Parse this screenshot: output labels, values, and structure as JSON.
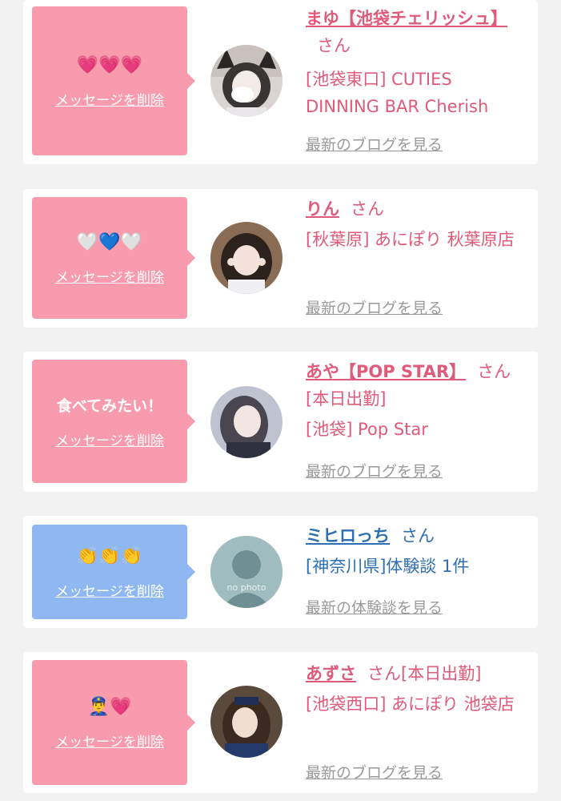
{
  "delete_label": "メッセージを削除",
  "colors": {
    "pink": "#f89bad",
    "blue": "#8fb8f2",
    "name_pink": "#e05a7a",
    "name_blue": "#2d6fb5"
  },
  "items": [
    {
      "message": "💗💗💗",
      "name": "まゆ【池袋チェリッシュ】",
      "san": "さん",
      "shop": "[池袋東口] CUTIES DINNING BAR Cherish",
      "more": "最新のブログを見る",
      "avatar": "girl-cat-ears-avatar"
    },
    {
      "message": "🤍💙🤍",
      "name": "りん",
      "san": "さん",
      "shop": "[秋葉原] あにぽり 秋葉原店",
      "more": "最新のブログを見る",
      "avatar": "girl-peace-sign-avatar"
    },
    {
      "message": "食べてみたい！",
      "name": "あや【POP STAR】",
      "san": "さん[本日出勤]",
      "shop": "[池袋] Pop Star",
      "more": "最新のブログを見る",
      "avatar": "girl-portrait-avatar"
    },
    {
      "message": "👏👏👏",
      "name": "ミヒロっち",
      "san": "さん",
      "shop": "[神奈川県]体験談 1件",
      "more": "最新の体験談を見る",
      "avatar": "no-photo-avatar",
      "avatar_text": "no photo"
    },
    {
      "message": "👮‍♂️💗",
      "name": "あずさ",
      "san": "さん[本日出勤]",
      "shop": "[池袋西口] あにぽり 池袋店",
      "more": "最新のブログを見る",
      "avatar": "girl-police-avatar"
    }
  ]
}
